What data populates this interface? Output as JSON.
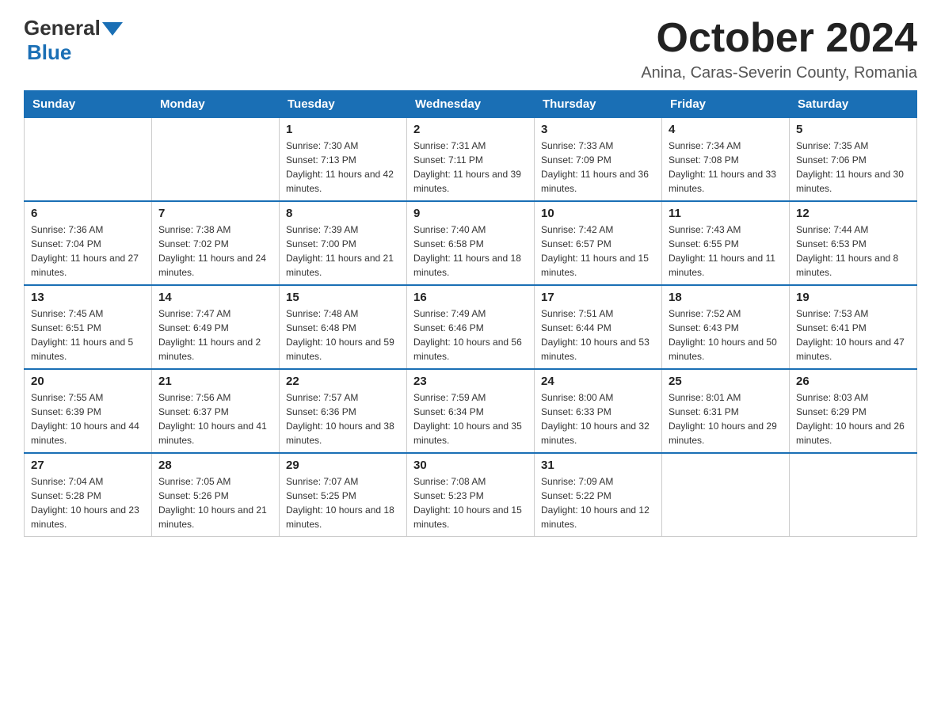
{
  "header": {
    "logo_general": "General",
    "logo_blue": "Blue",
    "month_title": "October 2024",
    "location": "Anina, Caras-Severin County, Romania"
  },
  "weekdays": [
    "Sunday",
    "Monday",
    "Tuesday",
    "Wednesday",
    "Thursday",
    "Friday",
    "Saturday"
  ],
  "weeks": [
    [
      {
        "day": "",
        "sunrise": "",
        "sunset": "",
        "daylight": ""
      },
      {
        "day": "",
        "sunrise": "",
        "sunset": "",
        "daylight": ""
      },
      {
        "day": "1",
        "sunrise": "Sunrise: 7:30 AM",
        "sunset": "Sunset: 7:13 PM",
        "daylight": "Daylight: 11 hours and 42 minutes."
      },
      {
        "day": "2",
        "sunrise": "Sunrise: 7:31 AM",
        "sunset": "Sunset: 7:11 PM",
        "daylight": "Daylight: 11 hours and 39 minutes."
      },
      {
        "day": "3",
        "sunrise": "Sunrise: 7:33 AM",
        "sunset": "Sunset: 7:09 PM",
        "daylight": "Daylight: 11 hours and 36 minutes."
      },
      {
        "day": "4",
        "sunrise": "Sunrise: 7:34 AM",
        "sunset": "Sunset: 7:08 PM",
        "daylight": "Daylight: 11 hours and 33 minutes."
      },
      {
        "day": "5",
        "sunrise": "Sunrise: 7:35 AM",
        "sunset": "Sunset: 7:06 PM",
        "daylight": "Daylight: 11 hours and 30 minutes."
      }
    ],
    [
      {
        "day": "6",
        "sunrise": "Sunrise: 7:36 AM",
        "sunset": "Sunset: 7:04 PM",
        "daylight": "Daylight: 11 hours and 27 minutes."
      },
      {
        "day": "7",
        "sunrise": "Sunrise: 7:38 AM",
        "sunset": "Sunset: 7:02 PM",
        "daylight": "Daylight: 11 hours and 24 minutes."
      },
      {
        "day": "8",
        "sunrise": "Sunrise: 7:39 AM",
        "sunset": "Sunset: 7:00 PM",
        "daylight": "Daylight: 11 hours and 21 minutes."
      },
      {
        "day": "9",
        "sunrise": "Sunrise: 7:40 AM",
        "sunset": "Sunset: 6:58 PM",
        "daylight": "Daylight: 11 hours and 18 minutes."
      },
      {
        "day": "10",
        "sunrise": "Sunrise: 7:42 AM",
        "sunset": "Sunset: 6:57 PM",
        "daylight": "Daylight: 11 hours and 15 minutes."
      },
      {
        "day": "11",
        "sunrise": "Sunrise: 7:43 AM",
        "sunset": "Sunset: 6:55 PM",
        "daylight": "Daylight: 11 hours and 11 minutes."
      },
      {
        "day": "12",
        "sunrise": "Sunrise: 7:44 AM",
        "sunset": "Sunset: 6:53 PM",
        "daylight": "Daylight: 11 hours and 8 minutes."
      }
    ],
    [
      {
        "day": "13",
        "sunrise": "Sunrise: 7:45 AM",
        "sunset": "Sunset: 6:51 PM",
        "daylight": "Daylight: 11 hours and 5 minutes."
      },
      {
        "day": "14",
        "sunrise": "Sunrise: 7:47 AM",
        "sunset": "Sunset: 6:49 PM",
        "daylight": "Daylight: 11 hours and 2 minutes."
      },
      {
        "day": "15",
        "sunrise": "Sunrise: 7:48 AM",
        "sunset": "Sunset: 6:48 PM",
        "daylight": "Daylight: 10 hours and 59 minutes."
      },
      {
        "day": "16",
        "sunrise": "Sunrise: 7:49 AM",
        "sunset": "Sunset: 6:46 PM",
        "daylight": "Daylight: 10 hours and 56 minutes."
      },
      {
        "day": "17",
        "sunrise": "Sunrise: 7:51 AM",
        "sunset": "Sunset: 6:44 PM",
        "daylight": "Daylight: 10 hours and 53 minutes."
      },
      {
        "day": "18",
        "sunrise": "Sunrise: 7:52 AM",
        "sunset": "Sunset: 6:43 PM",
        "daylight": "Daylight: 10 hours and 50 minutes."
      },
      {
        "day": "19",
        "sunrise": "Sunrise: 7:53 AM",
        "sunset": "Sunset: 6:41 PM",
        "daylight": "Daylight: 10 hours and 47 minutes."
      }
    ],
    [
      {
        "day": "20",
        "sunrise": "Sunrise: 7:55 AM",
        "sunset": "Sunset: 6:39 PM",
        "daylight": "Daylight: 10 hours and 44 minutes."
      },
      {
        "day": "21",
        "sunrise": "Sunrise: 7:56 AM",
        "sunset": "Sunset: 6:37 PM",
        "daylight": "Daylight: 10 hours and 41 minutes."
      },
      {
        "day": "22",
        "sunrise": "Sunrise: 7:57 AM",
        "sunset": "Sunset: 6:36 PM",
        "daylight": "Daylight: 10 hours and 38 minutes."
      },
      {
        "day": "23",
        "sunrise": "Sunrise: 7:59 AM",
        "sunset": "Sunset: 6:34 PM",
        "daylight": "Daylight: 10 hours and 35 minutes."
      },
      {
        "day": "24",
        "sunrise": "Sunrise: 8:00 AM",
        "sunset": "Sunset: 6:33 PM",
        "daylight": "Daylight: 10 hours and 32 minutes."
      },
      {
        "day": "25",
        "sunrise": "Sunrise: 8:01 AM",
        "sunset": "Sunset: 6:31 PM",
        "daylight": "Daylight: 10 hours and 29 minutes."
      },
      {
        "day": "26",
        "sunrise": "Sunrise: 8:03 AM",
        "sunset": "Sunset: 6:29 PM",
        "daylight": "Daylight: 10 hours and 26 minutes."
      }
    ],
    [
      {
        "day": "27",
        "sunrise": "Sunrise: 7:04 AM",
        "sunset": "Sunset: 5:28 PM",
        "daylight": "Daylight: 10 hours and 23 minutes."
      },
      {
        "day": "28",
        "sunrise": "Sunrise: 7:05 AM",
        "sunset": "Sunset: 5:26 PM",
        "daylight": "Daylight: 10 hours and 21 minutes."
      },
      {
        "day": "29",
        "sunrise": "Sunrise: 7:07 AM",
        "sunset": "Sunset: 5:25 PM",
        "daylight": "Daylight: 10 hours and 18 minutes."
      },
      {
        "day": "30",
        "sunrise": "Sunrise: 7:08 AM",
        "sunset": "Sunset: 5:23 PM",
        "daylight": "Daylight: 10 hours and 15 minutes."
      },
      {
        "day": "31",
        "sunrise": "Sunrise: 7:09 AM",
        "sunset": "Sunset: 5:22 PM",
        "daylight": "Daylight: 10 hours and 12 minutes."
      },
      {
        "day": "",
        "sunrise": "",
        "sunset": "",
        "daylight": ""
      },
      {
        "day": "",
        "sunrise": "",
        "sunset": "",
        "daylight": ""
      }
    ]
  ]
}
